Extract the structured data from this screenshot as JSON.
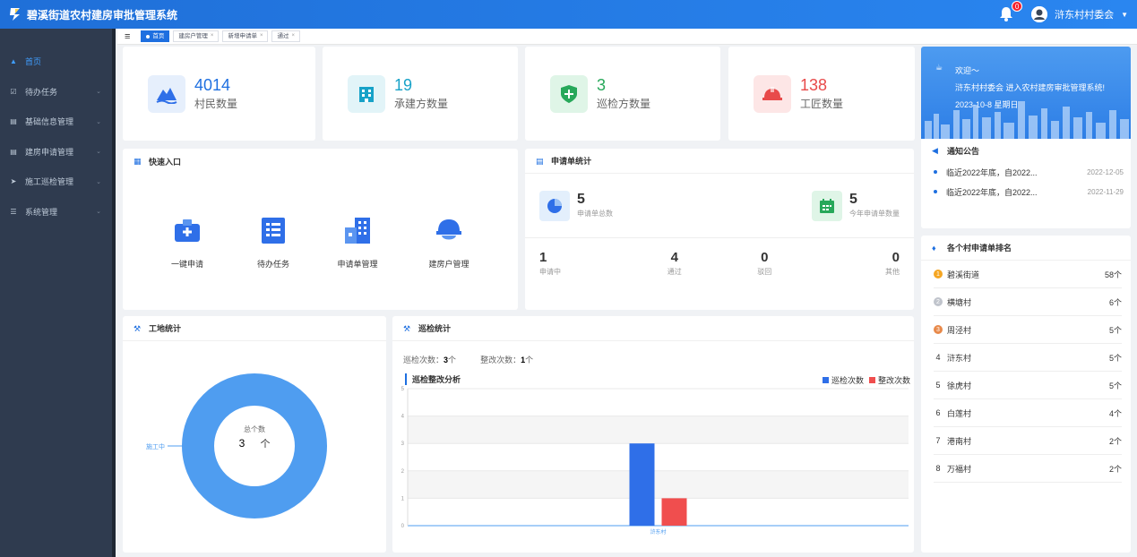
{
  "header": {
    "title": "碧溪街道农村建房审批管理系统",
    "notification_count": "0",
    "user": "浒东村村委会"
  },
  "sidebar": {
    "items": [
      {
        "label": "首页",
        "icon": "home-icon"
      },
      {
        "label": "待办任务",
        "icon": "task-icon"
      },
      {
        "label": "基础信息管理",
        "icon": "doc-icon"
      },
      {
        "label": "建房申请管理",
        "icon": "doc-icon"
      },
      {
        "label": "施工巡检管理",
        "icon": "send-icon"
      },
      {
        "label": "系统管理",
        "icon": "settings-icon"
      }
    ]
  },
  "tabs": [
    {
      "label": "首页"
    },
    {
      "label": "建房户管理"
    },
    {
      "label": "新增申请单"
    },
    {
      "label": "通过"
    }
  ],
  "stats": [
    {
      "value": "4014",
      "label": "村民数量",
      "color": "#1e6fe0"
    },
    {
      "value": "19",
      "label": "承建方数量",
      "color": "#17a2c8"
    },
    {
      "value": "3",
      "label": "巡检方数量",
      "color": "#27a85a"
    },
    {
      "value": "138",
      "label": "工匠数量",
      "color": "#e84a4a"
    }
  ],
  "quick_entry": {
    "title": "快速入口",
    "items": [
      {
        "label": "一键申请"
      },
      {
        "label": "待办任务"
      },
      {
        "label": "申请单管理"
      },
      {
        "label": "建房户管理"
      }
    ]
  },
  "application_stats": {
    "title": "申请单统计",
    "total": {
      "value": "5",
      "label": "申请单总数"
    },
    "this_year": {
      "value": "5",
      "label": "今年申请单数量"
    },
    "breakdown": [
      {
        "value": "1",
        "label": "申请中"
      },
      {
        "value": "4",
        "label": "通过"
      },
      {
        "value": "0",
        "label": "驳回"
      },
      {
        "value": "0",
        "label": "其他"
      }
    ]
  },
  "welcome": {
    "greeting": "欢迎～",
    "message": "浒东村村委会 进入农村建房审批管理系统!",
    "date": "2023-10-8 星期日"
  },
  "notices": {
    "title": "通知公告",
    "items": [
      {
        "text": "临近2022年底，自2022...",
        "date": "2022-12-05"
      },
      {
        "text": "临近2022年底，自2022...",
        "date": "2022-11-29"
      }
    ]
  },
  "ranking": {
    "title": "各个村申请单排名",
    "items": [
      {
        "rank": "1",
        "name": "碧溪街道",
        "count": "58个"
      },
      {
        "rank": "2",
        "name": "横塘村",
        "count": "6个"
      },
      {
        "rank": "3",
        "name": "周泾村",
        "count": "5个"
      },
      {
        "rank": "4",
        "name": "浒东村",
        "count": "5个"
      },
      {
        "rank": "5",
        "name": "徐虎村",
        "count": "5个"
      },
      {
        "rank": "6",
        "name": "白莲村",
        "count": "4个"
      },
      {
        "rank": "7",
        "name": "港南村",
        "count": "2个"
      },
      {
        "rank": "8",
        "name": "万福村",
        "count": "2个"
      }
    ]
  },
  "site_stats": {
    "title": "工地统计",
    "center_label": "总个数",
    "center_value": "3",
    "center_unit": "个",
    "slice_label": "施工中",
    "color": "#4f9df0"
  },
  "patrol": {
    "title": "巡检统计",
    "patrol_label": "巡检次数：",
    "patrol_value": "3",
    "patrol_unit": "个",
    "rectify_label": "整改次数：",
    "rectify_value": "1",
    "rectify_unit": "个",
    "chart_title": "巡检整改分析"
  },
  "chart_data": [
    {
      "type": "bar",
      "title": "巡检整改分析",
      "categories": [
        "浒东村"
      ],
      "series": [
        {
          "name": "巡检次数",
          "values": [
            3
          ],
          "color": "#2f6fe8"
        },
        {
          "name": "整改次数",
          "values": [
            1
          ],
          "color": "#f04e4e"
        }
      ],
      "ylim": [
        0,
        5
      ],
      "yticks": [
        "0",
        "1",
        "2",
        "3",
        "4",
        "5"
      ],
      "legend": "top-right"
    },
    {
      "type": "pie",
      "title": "工地统计",
      "categories": [
        "施工中"
      ],
      "values": [
        3
      ]
    }
  ]
}
